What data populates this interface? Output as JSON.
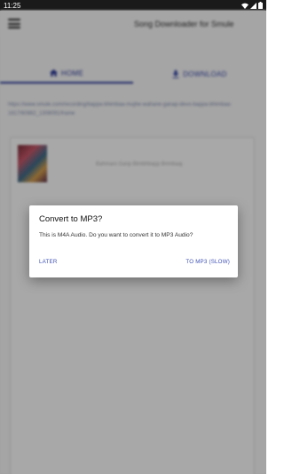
{
  "status_bar": {
    "time": "11:25"
  },
  "app": {
    "title": "Song Downloader for Smule",
    "tabs": [
      {
        "label": "HOME",
        "icon": "home-icon",
        "active": true
      },
      {
        "label": "DOWNLOAD",
        "icon": "download-icon",
        "active": false
      }
    ],
    "link_text": "https://www.smule.com/recording/bappa-bhimbaa-mujhe-wahane-ganap-devo-bappa-bhimbaa-1617/60882_1308091/frame",
    "result": {
      "song_title": "Bahmani Ganp Bimbhbapp Brimbaaj"
    }
  },
  "dialog": {
    "title": "Convert to MP3?",
    "message": "This is M4A Audio. Do you want to convert it to MP3 Audio?",
    "negative_label": "LATER",
    "positive_label": "TO MP3 (SLOW)"
  },
  "colors": {
    "accent": "#3f51b5",
    "scrim": "#000000"
  }
}
